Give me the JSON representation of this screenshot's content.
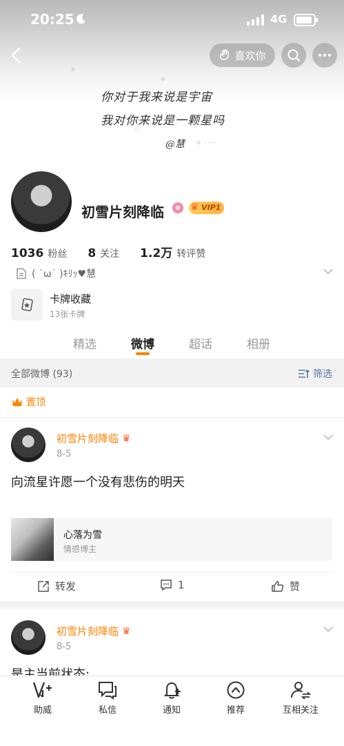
{
  "status_bar": {
    "time": "20:25",
    "network": "4G"
  },
  "header": {
    "like_label": "喜欢你"
  },
  "cover": {
    "line1": "你对于我来说是宇宙",
    "line2": "我对你来说是一颗星吗",
    "signature": "@慧"
  },
  "profile": {
    "name": "初雪片刻降临",
    "vip_label": "VIP1",
    "stats": {
      "followers_value": "1036",
      "followers_label": "粉丝",
      "following_value": "8",
      "following_label": "关注",
      "likes_value": "1.2万",
      "likes_label": "转评赞"
    },
    "bio": "( ˙ω˙ )ｷﾘｯ♥慧",
    "card_collection": {
      "title": "卡牌收藏",
      "subtitle": "13张卡牌"
    }
  },
  "tabs": [
    {
      "label": "精选"
    },
    {
      "label": "微博"
    },
    {
      "label": "超话"
    },
    {
      "label": "相册"
    }
  ],
  "filter_bar": {
    "all_posts": "全部微博 (93)",
    "filter_label": "筛选"
  },
  "pinned_label": "置顶",
  "posts": [
    {
      "author": "初雪片刻降临",
      "date": "8-5",
      "text": "向流星许愿一个没有悲伤的明天",
      "share": {
        "title": "心落为雪",
        "subtitle": "情感博主"
      },
      "actions": {
        "repost": "转发",
        "comment": "1",
        "like": "赞"
      }
    },
    {
      "author": "初雪片刻降临",
      "date": "8-5",
      "text": "是主当前状态:"
    }
  ],
  "bottom_nav": [
    {
      "label": "助威",
      "icon": "cheer-icon"
    },
    {
      "label": "私信",
      "icon": "message-icon"
    },
    {
      "label": "通知",
      "icon": "bell-icon"
    },
    {
      "label": "推荐",
      "icon": "recommend-icon"
    },
    {
      "label": "互相关注",
      "icon": "mutual-follow-icon"
    }
  ],
  "colors": {
    "accent": "#ff8200",
    "link": "#5877a7"
  }
}
